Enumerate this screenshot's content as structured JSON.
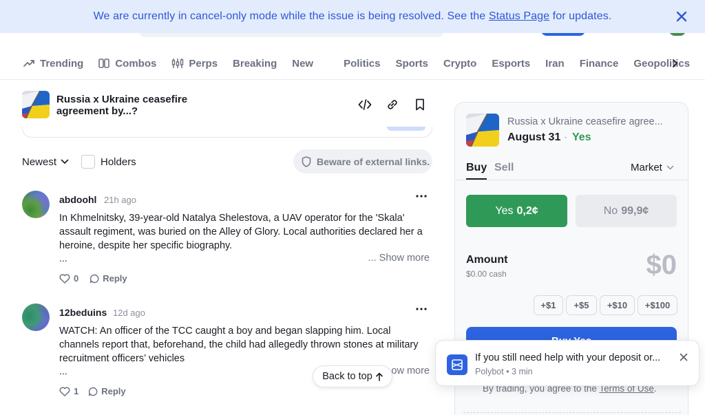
{
  "banner": {
    "text_before": "We are currently in cancel-only mode while the issue is being resolved. See the ",
    "link": "Status Page",
    "text_after": " for updates."
  },
  "categories": [
    {
      "label": "Trending",
      "icon": "trending-icon"
    },
    {
      "label": "Combos",
      "icon": "combos-icon"
    },
    {
      "label": "Perps",
      "icon": "perps-icon"
    },
    {
      "label": "Breaking"
    },
    {
      "label": "New"
    },
    {
      "label": "Politics"
    },
    {
      "label": "Sports"
    },
    {
      "label": "Crypto"
    },
    {
      "label": "Esports"
    },
    {
      "label": "Iran"
    },
    {
      "label": "Finance"
    },
    {
      "label": "Geopolitics"
    }
  ],
  "market": {
    "title": "Russia x Ukraine ceasefire agreement by...?",
    "flag_icon": "russia-ukraine-flag-image"
  },
  "comments_toolbar": {
    "sort_label": "Newest",
    "holders_label": "Holders",
    "beware": "Beware of external links."
  },
  "comments": [
    {
      "user": "abdoohl",
      "time": "21h ago",
      "body": "In Khmelnitsky, 39-year-old Natalya Shelestova, a UAV operator for the 'Skala' assault regiment, was buried on the Alley of Glory. Local authorities declared her a heroine, despite her specific biography.",
      "ellipsis": "...",
      "show_more": "... Show more",
      "likes": "0",
      "reply": "Reply"
    },
    {
      "user": "12beduins",
      "time": "12d ago",
      "body": "WATCH: An officer of the TCC caught a boy and began slapping him. Local channels report that, beforehand, the child had allegedly thrown stones at military recruitment officers’ vehicles",
      "ellipsis": "...",
      "show_more": "ow more",
      "likes": "1",
      "reply": "Reply"
    }
  ],
  "back_to_top": "Back to top",
  "panel": {
    "title": "Russia x Ukraine ceasefire agree...",
    "date": "August 31",
    "dot": "·",
    "outcome": "Yes",
    "tab_buy": "Buy",
    "tab_sell": "Sell",
    "order_type": "Market",
    "yes_label": "Yes",
    "yes_price": "0,2¢",
    "no_label": "No",
    "no_price": "99,9¢",
    "amount_label": "Amount",
    "cash": "$0.00 cash",
    "amount_value": "$0",
    "quick": [
      "+$1",
      "+$5",
      "+$10",
      "+$100"
    ],
    "buy_button": "Buy Yes",
    "terms_prefix": "By trading, you agree to the ",
    "terms_link": "Terms of Use",
    "terms_suffix": "."
  },
  "toast": {
    "message": "If you still need help with your deposit or...",
    "sender": "Polybot",
    "sep": " • ",
    "time": "3 min"
  },
  "colors": {
    "accent_blue": "#2d63e0",
    "yes_green": "#2f9a57",
    "banner_bg": "#e3ecfd"
  }
}
